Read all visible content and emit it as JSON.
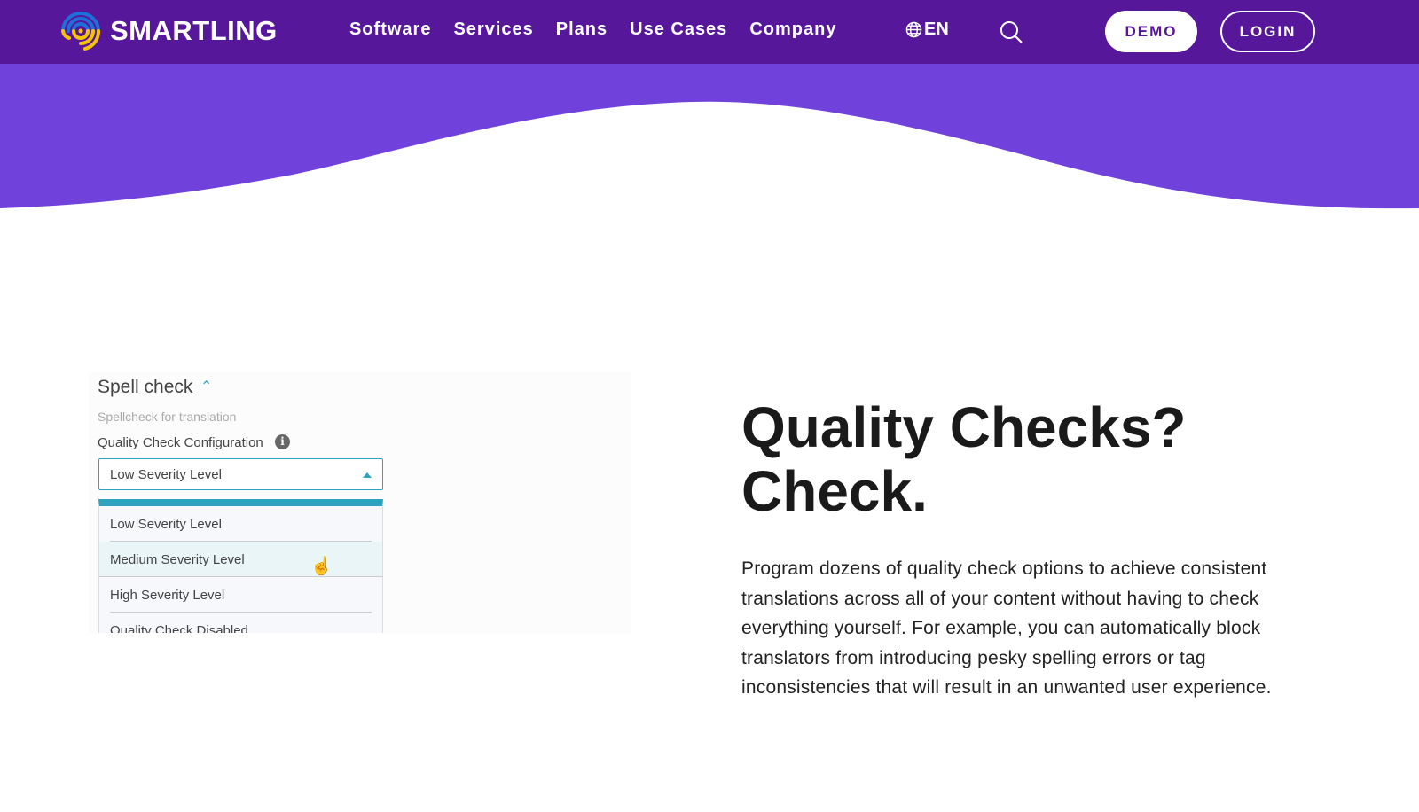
{
  "nav": {
    "brand": "SMARTLING",
    "items": [
      "Software",
      "Services",
      "Plans",
      "Use Cases",
      "Company"
    ],
    "language": "EN",
    "demo": "DEMO",
    "login": "LOGIN"
  },
  "colors": {
    "nav": "#56179a",
    "hero": "#7141dc",
    "accent": "#2ea3c0"
  },
  "screenshot": {
    "title": "Spell check",
    "subtitle": "Spellcheck for translation",
    "config_label": "Quality Check Configuration",
    "selected": "Low Severity Level",
    "options": [
      "Low Severity Level",
      "Medium Severity Level",
      "High Severity Level",
      "Quality Check Disabled"
    ]
  },
  "content": {
    "heading": "Quality Checks? Check.",
    "body": "Program dozens of quality check options to achieve consistent translations across all of your content without having to check everything yourself. For example, you can automatically block translators from introducing pesky spelling errors or tag inconsistencies that will result in an unwanted user experience."
  }
}
